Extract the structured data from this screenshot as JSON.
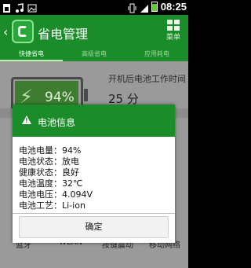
{
  "status_bar": {
    "time": "08:25",
    "icons": [
      "sim-icon",
      "music-icon",
      "image-icon",
      "vibrate-icon",
      "signal-icon",
      "battery-icon"
    ],
    "battery_level": 0.94
  },
  "app": {
    "title": "省电管理",
    "menu_label": "菜单"
  },
  "tabs": [
    {
      "label": "快捷省电",
      "active": true
    },
    {
      "label": "高级省电",
      "active": false
    },
    {
      "label": "应用耗电",
      "active": false
    }
  ],
  "main": {
    "battery_percent": "94%",
    "remaining_label": "开机后电池工作时间",
    "remaining_value": "25 分"
  },
  "quick_buttons": [
    {
      "label": "蓝牙",
      "icon": "bluetooth-icon"
    },
    {
      "label": "WLAN",
      "icon": "wifi-icon"
    },
    {
      "label": "按键震动",
      "icon": "vibration-icon"
    },
    {
      "label": "移动网络",
      "icon": "mobile-network-icon"
    }
  ],
  "dialog": {
    "title": "电池信息",
    "rows": [
      "电池电量：94%",
      "电池状态：放电",
      "健康状态：良好",
      "电池温度：32℃",
      "电池电压：4.094V",
      "电池工艺：Li-ion"
    ],
    "ok_label": "确定"
  },
  "colors": {
    "brand_green": "#1a8d2a",
    "overlay_gray": "#9a9a9a"
  }
}
